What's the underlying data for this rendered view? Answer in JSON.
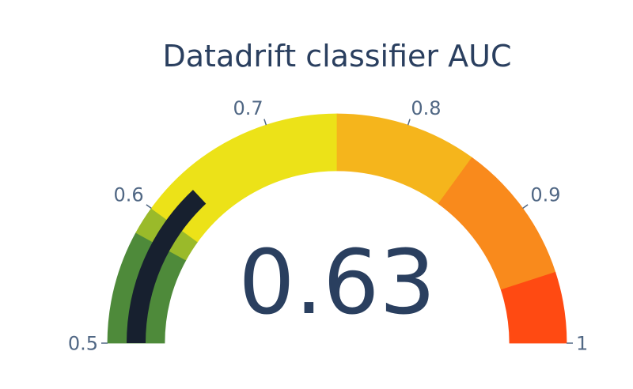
{
  "chart_data": {
    "type": "gauge",
    "title": "Datadrift classifier AUC",
    "value": 0.63,
    "value_label": "0.63",
    "range": [
      0.5,
      1
    ],
    "ticks": [
      {
        "value": 0.5,
        "label": "0.5"
      },
      {
        "value": 0.6,
        "label": "0.6"
      },
      {
        "value": 0.7,
        "label": "0.7"
      },
      {
        "value": 0.8,
        "label": "0.8"
      },
      {
        "value": 0.9,
        "label": "0.9"
      },
      {
        "value": 1.0,
        "label": "1"
      }
    ],
    "steps": [
      {
        "range": [
          0.5,
          0.58
        ],
        "color": "#4e8a3a"
      },
      {
        "range": [
          0.58,
          0.6
        ],
        "color": "#9aba2a"
      },
      {
        "range": [
          0.6,
          0.75
        ],
        "color": "#ece218"
      },
      {
        "range": [
          0.75,
          0.85
        ],
        "color": "#f5b51c"
      },
      {
        "range": [
          0.85,
          0.95
        ],
        "color": "#f98a1c"
      },
      {
        "range": [
          0.95,
          1.0
        ],
        "color": "#ff4a12"
      }
    ],
    "bar_color": "#17202f"
  }
}
